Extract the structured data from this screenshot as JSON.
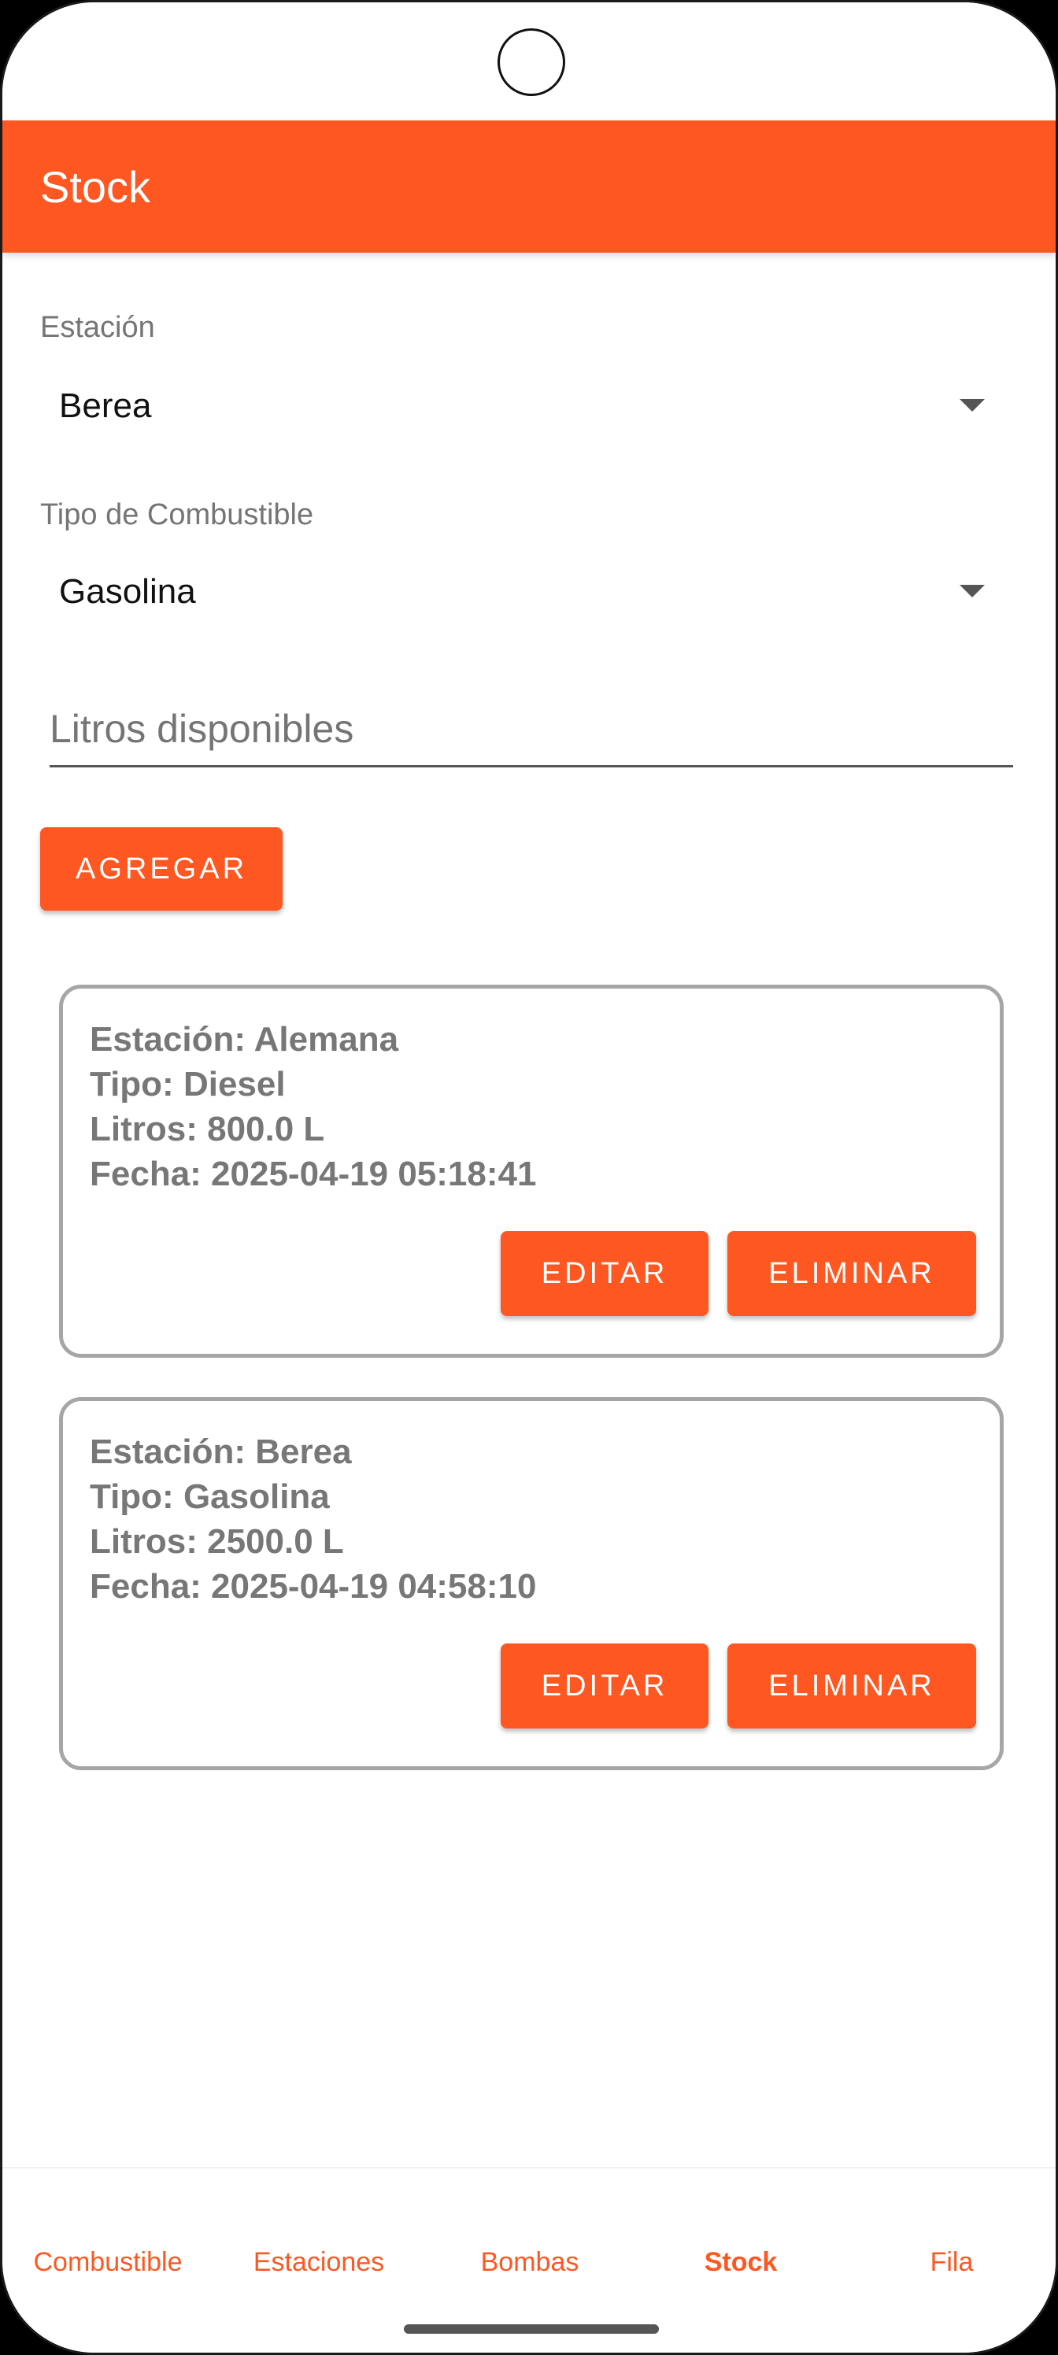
{
  "appbar": {
    "title": "Stock"
  },
  "form": {
    "station_label": "Estación",
    "station_value": "Berea",
    "fuel_label": "Tipo de Combustible",
    "fuel_value": "Gasolina",
    "liters_placeholder": "Litros disponibles",
    "add_button": "AGREGAR"
  },
  "records": [
    {
      "station": "Estación: Alemana",
      "type": "Tipo: Diesel",
      "liters": "Litros: 800.0 L",
      "date": "Fecha: 2025-04-19 05:18:41",
      "edit": "EDITAR",
      "delete": "ELIMINAR"
    },
    {
      "station": "Estación: Berea",
      "type": "Tipo: Gasolina",
      "liters": "Litros: 2500.0 L",
      "date": "Fecha: 2025-04-19 04:58:10",
      "edit": "EDITAR",
      "delete": "ELIMINAR"
    }
  ],
  "bottom_nav": {
    "items": [
      "Combustible",
      "Estaciones",
      "Bombas",
      "Stock",
      "Fila"
    ],
    "active": "Stock"
  },
  "colors": {
    "accent": "#FF5722"
  }
}
